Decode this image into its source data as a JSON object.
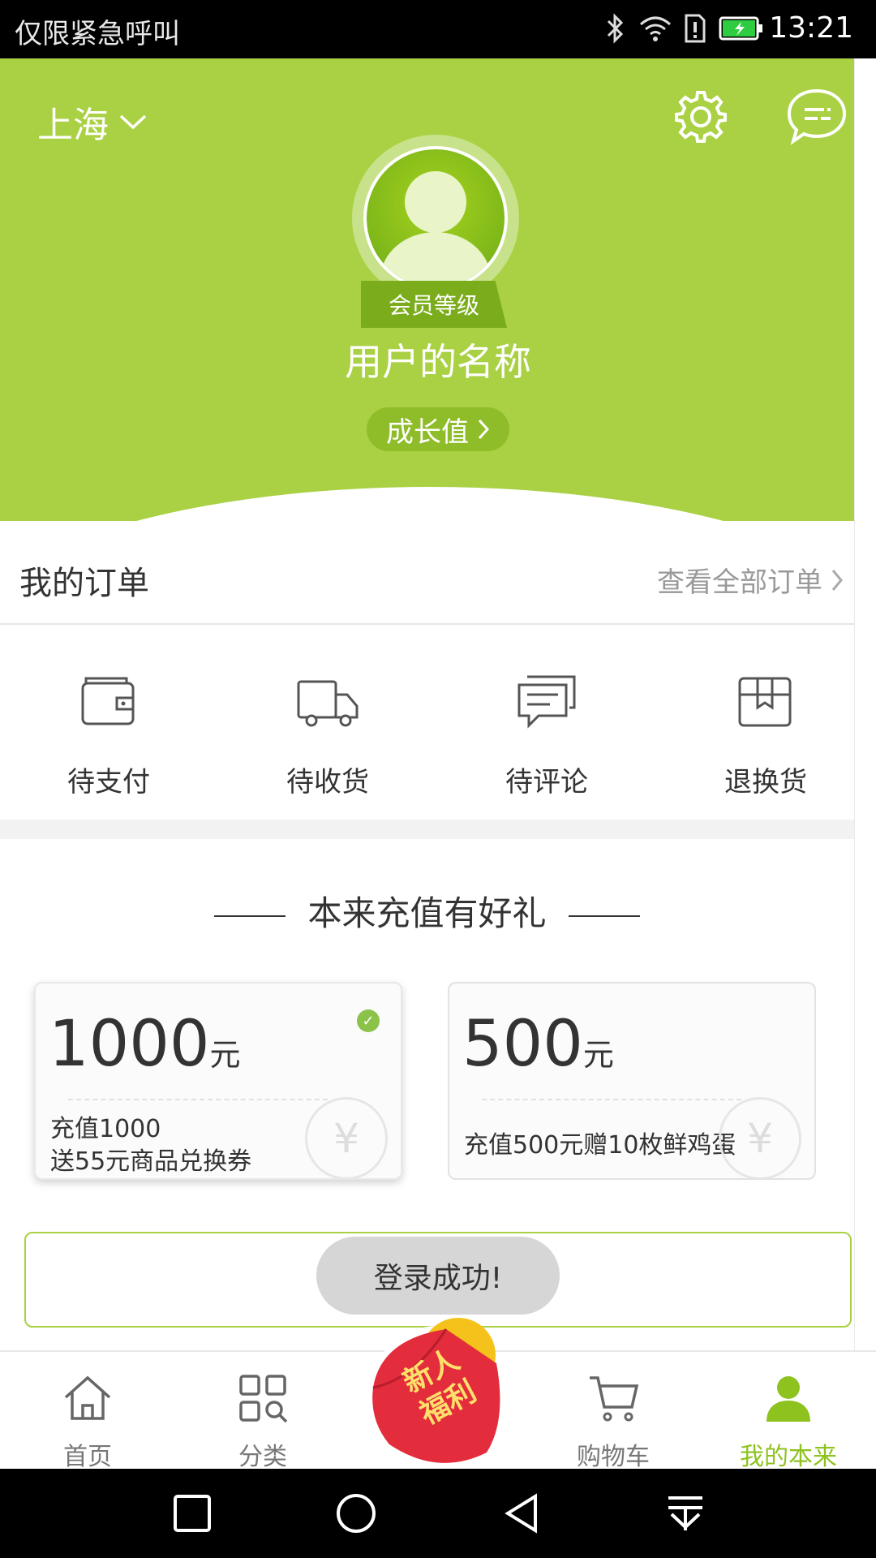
{
  "status_bar": {
    "carrier_text": "仅限紧急呼叫",
    "time": "13:21",
    "icons": [
      "bluetooth-icon",
      "wifi-icon",
      "sim-alert-icon",
      "battery-icon"
    ]
  },
  "header": {
    "city": "上海",
    "settings_icon": "gear-icon",
    "message_icon": "message-icon",
    "member_level": "会员等级",
    "username": "用户的名称",
    "growth_label": "成长值",
    "bg_color": "#a9d143"
  },
  "orders": {
    "title": "我的订单",
    "view_all": "查看全部订单",
    "items": [
      {
        "label": "待支付",
        "icon": "wallet-icon"
      },
      {
        "label": "待收货",
        "icon": "truck-icon"
      },
      {
        "label": "待评论",
        "icon": "comment-icon"
      },
      {
        "label": "退换货",
        "icon": "box-icon"
      }
    ]
  },
  "recharge": {
    "title": "本来充值有好礼",
    "cards": [
      {
        "amount": "1000",
        "unit": "元",
        "desc_line1": "充值1000",
        "desc_line2": "送55元商品兑换券",
        "selected": true
      },
      {
        "amount": "500",
        "unit": "元",
        "desc_line1": "充值500元赠10枚鲜鸡蛋",
        "desc_line2": "",
        "selected": false
      }
    ],
    "toast": "登录成功!"
  },
  "promo": {
    "line1": "新人",
    "line2": "福利"
  },
  "bottom_nav": [
    {
      "label": "首页",
      "icon": "home-icon"
    },
    {
      "label": "分类",
      "icon": "category-icon"
    },
    {
      "label": "购物车",
      "icon": "cart-icon"
    },
    {
      "label": "我的本来",
      "icon": "user-icon",
      "active": true
    }
  ],
  "accent_color": "#8ec21f"
}
